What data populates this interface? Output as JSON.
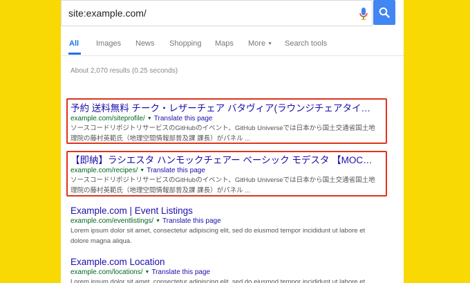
{
  "search": {
    "query": "site:example.com/"
  },
  "tabs": [
    {
      "label": "All"
    },
    {
      "label": "Images"
    },
    {
      "label": "News"
    },
    {
      "label": "Shopping"
    },
    {
      "label": "Maps"
    },
    {
      "label": "More"
    },
    {
      "label": "Search tools"
    }
  ],
  "stats": "About 2,070 results (0.25 seconds)",
  "results": [
    {
      "title": "予約 送料無料 チーク・レザーチェア バタヴィア(ラウンジチェアタイプ ...",
      "url": "example.com/siteprofile/",
      "translate": "Translate this page",
      "snippet": "ソースコードリポジトリサービスのGitHubのイベント、GitHub Universeでは日本から国土交通省国土地理院の藤村英範氏（地理空間情報部普及課 課長）がパネル ..."
    },
    {
      "title": "【即納】ラシエスタ ハンモックチェアー ベーシック モデスタ 【MOC1...",
      "url": "example.com/recipes/",
      "translate": "Translate this page",
      "snippet": "ソースコードリポジトリサービスのGitHubのイベント、GitHub Universeでは日本から国土交通省国土地理院の藤村英範氏（地理空間情報部普及課 課長）がパネル ..."
    },
    {
      "title": "Example.com | Event Listings",
      "url": "example.com/eventlistings/",
      "translate": "Translate this page",
      "snippet": "Lorem ipsum dolor sit amet, consectetur adipiscing elit, sed do eiusmod tempor incididunt ut labore et dolore magna aliqua."
    },
    {
      "title": "Example.com Location",
      "url": "example.com/locations/",
      "translate": "Translate this page",
      "snippet": "Lorem ipsum dolor sit amet, consectetur adipiscing elit, sed do eiusmod tempor incididunt ut labore et"
    }
  ],
  "colors": {
    "background": "#F9D904",
    "accent": "#4285F4",
    "link": "#1a0dab",
    "url": "#006621",
    "highlight_border": "#e0321e"
  },
  "icons": {
    "mic": "mic-icon",
    "search": "search-icon",
    "dropdown": "caret-down-icon"
  }
}
